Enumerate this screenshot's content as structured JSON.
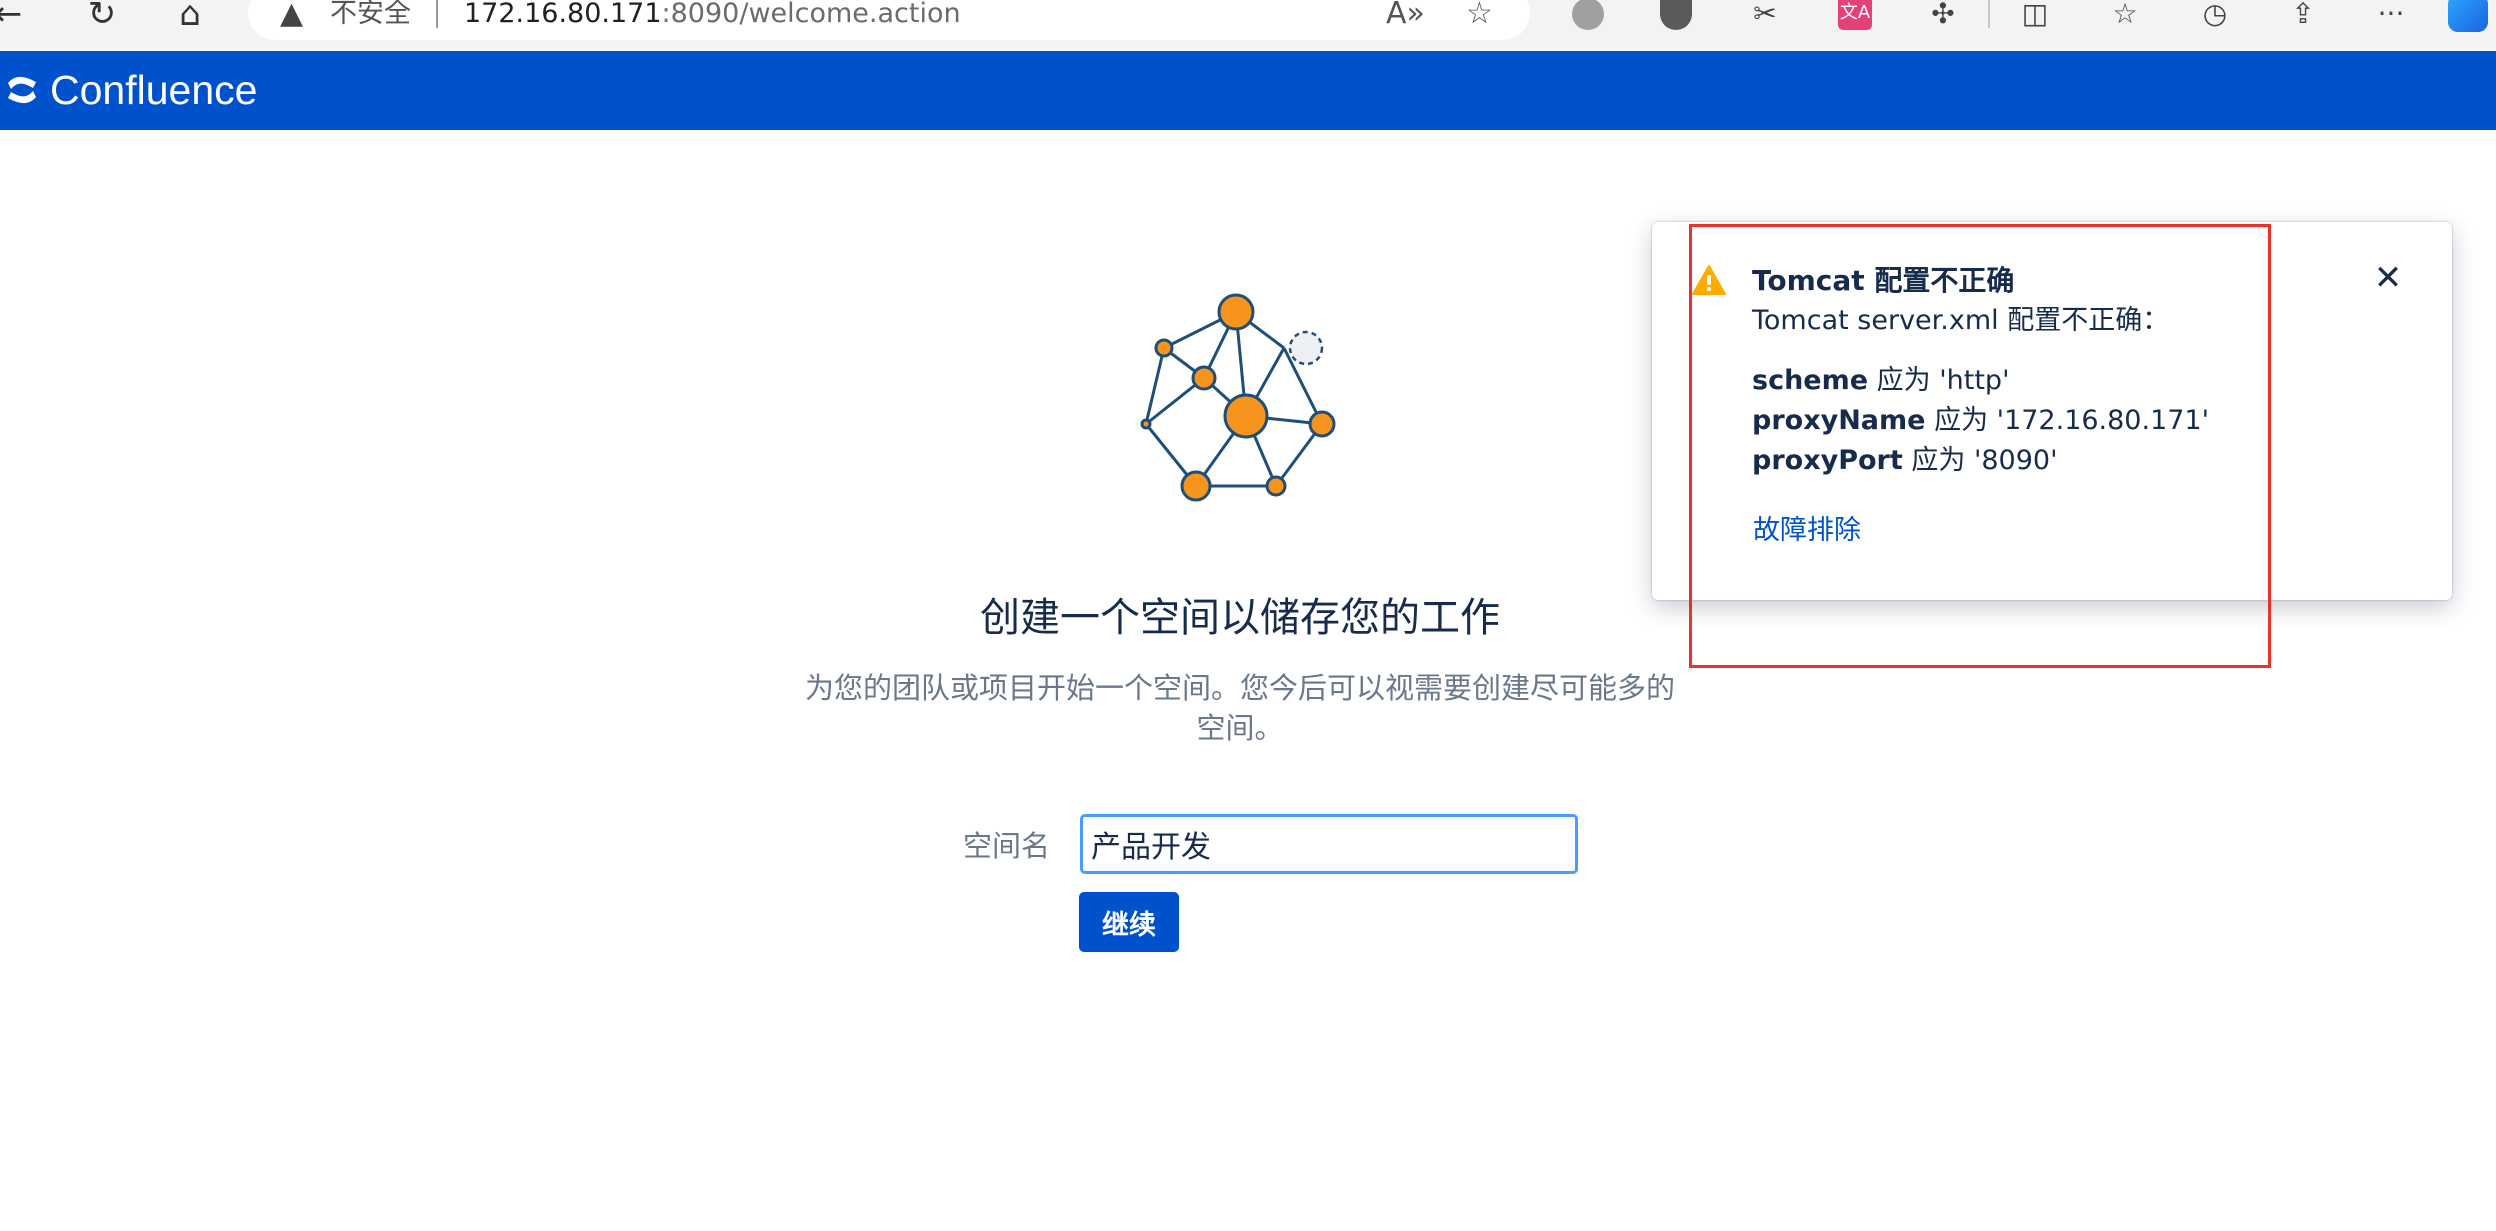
{
  "browser": {
    "back_glyph": "←",
    "reload_glyph": "↻",
    "home_glyph": "⌂",
    "security_warning_icon": "warning-triangle-icon",
    "security_label": "不安全",
    "url_host": "172.16.80.171",
    "url_rest": ":8090/welcome.action",
    "read_aloud_glyph": "A»",
    "favorite_glyph": "☆",
    "translate_label": "文A",
    "menu_glyph": "···"
  },
  "header": {
    "brand_name": "Confluence",
    "brand_color": "#0052cc"
  },
  "main": {
    "heading": "创建一个空间以储存您的工作",
    "description": "为您的团队或项目开始一个空间。您今后可以视需要创建尽可能多的空间。",
    "space_name_label": "空间名",
    "space_name_value": "产品开发",
    "continue_label": "继续"
  },
  "flag": {
    "title": "Tomcat 配置不正确",
    "subtitle": "Tomcat server.xml 配置不正确：",
    "items": [
      {
        "key": "scheme",
        "text": " 应为 'http'"
      },
      {
        "key": "proxyName",
        "text": " 应为 '172.16.80.171'"
      },
      {
        "key": "proxyPort",
        "text": " 应为 '8090'"
      }
    ],
    "link_label": "故障排除",
    "close_glyph": "✕",
    "warning_color": "#ffab00",
    "highlight_color": "#e8322b"
  }
}
